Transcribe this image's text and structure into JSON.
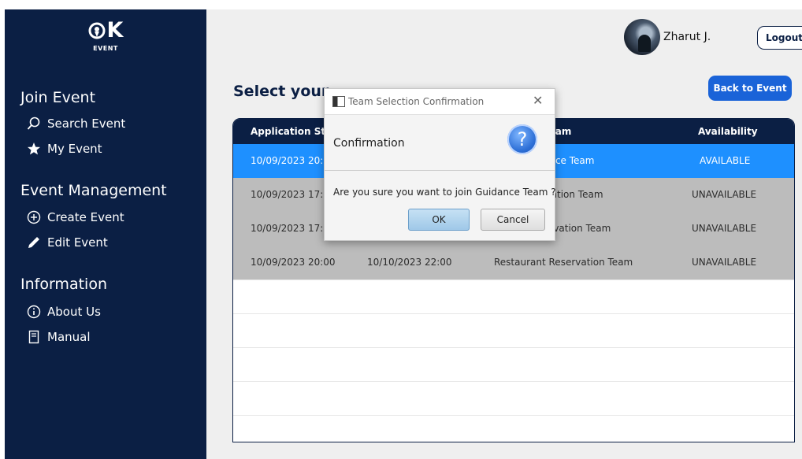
{
  "sidebar": {
    "logo_text": "OK",
    "logo_sub": "EVENT",
    "sections": [
      {
        "title": "Join Event",
        "items": [
          {
            "label": "Search Event",
            "icon": "search-icon"
          },
          {
            "label": "My Event",
            "icon": "star-icon"
          }
        ]
      },
      {
        "title": "Event Management",
        "items": [
          {
            "label": "Create Event",
            "icon": "plus-circle-icon"
          },
          {
            "label": "Edit Event",
            "icon": "pencil-icon"
          }
        ]
      },
      {
        "title": "Information",
        "items": [
          {
            "label": "About Us",
            "icon": "info-icon"
          },
          {
            "label": "Manual",
            "icon": "manual-icon"
          }
        ]
      }
    ]
  },
  "header": {
    "user_name": "Zharut J.",
    "logout_label": "Logout"
  },
  "main": {
    "heading": "Select your",
    "back_label": "Back to Event",
    "table": {
      "columns": [
        "Application St",
        "",
        "Team",
        "Availability"
      ],
      "rows": [
        {
          "start": "10/09/2023 20:",
          "end": "",
          "team": "ance Team",
          "availability": "AVAILABLE",
          "state": "selected"
        },
        {
          "start": "10/09/2023 17:",
          "end": "",
          "team": "rtation Team",
          "availability": "UNAVAILABLE",
          "state": "unavailable"
        },
        {
          "start": "10/09/2023 17:",
          "end": "",
          "team": "ervation Team",
          "availability": "UNAVAILABLE",
          "state": "unavailable"
        },
        {
          "start": "10/09/2023 20:00",
          "end": "10/10/2023 22:00",
          "team": "Restaurant Reservation Team",
          "availability": "UNAVAILABLE",
          "state": "unavailable"
        }
      ]
    }
  },
  "dialog": {
    "title": "Team Selection Confirmation",
    "heading": "Confirmation",
    "message": "Are you sure you want to join Guidance Team ?",
    "ok_label": "OK",
    "cancel_label": "Cancel",
    "icon": "question-icon"
  },
  "colors": {
    "sidebar": "#0b1f44",
    "accent": "#1a63d8",
    "selected_row": "#1e90ff",
    "unavailable_row": "#bcbcbc"
  }
}
